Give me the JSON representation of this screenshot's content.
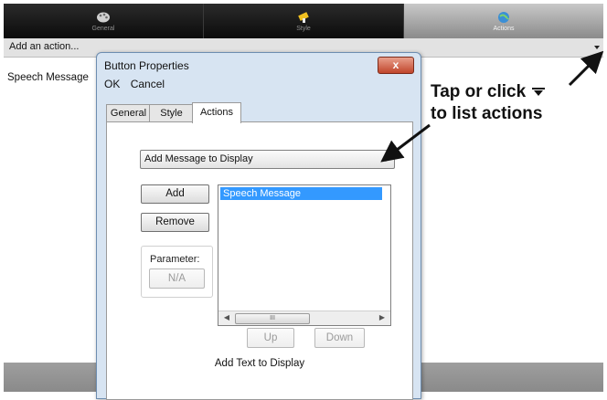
{
  "top_tabs": [
    {
      "label": "General",
      "icon": "paint-palette-icon",
      "active": false
    },
    {
      "label": "Style",
      "icon": "paint-brush-icon",
      "active": false
    },
    {
      "label": "Actions",
      "icon": "globe-icon",
      "active": true
    }
  ],
  "action_bar": {
    "label": "Add an action..."
  },
  "app_list": {
    "items": [
      "Speech Message"
    ]
  },
  "dialog": {
    "title": "Button Properties",
    "close_label": "x",
    "menu": [
      "OK",
      "Cancel"
    ],
    "tabs": [
      "General",
      "Style",
      "Actions"
    ],
    "active_tab": "Actions",
    "action_select": {
      "value": "Add Message to Display"
    },
    "buttons": {
      "add": "Add",
      "remove": "Remove",
      "parameter_value": "N/A",
      "up": "Up",
      "down": "Down"
    },
    "parameter_label": "Parameter:",
    "action_list": [
      "Speech Message"
    ],
    "scroll_thumb_label": "III",
    "status_text": "Add Text to Display"
  },
  "annotation": {
    "line1": "Tap or click",
    "line2": "to list actions"
  },
  "colors": {
    "dialog_bg": "#d7e4f2",
    "selection": "#3399ff",
    "close_button": "#c0452b",
    "active_top_tab": "#a8a8a8"
  }
}
